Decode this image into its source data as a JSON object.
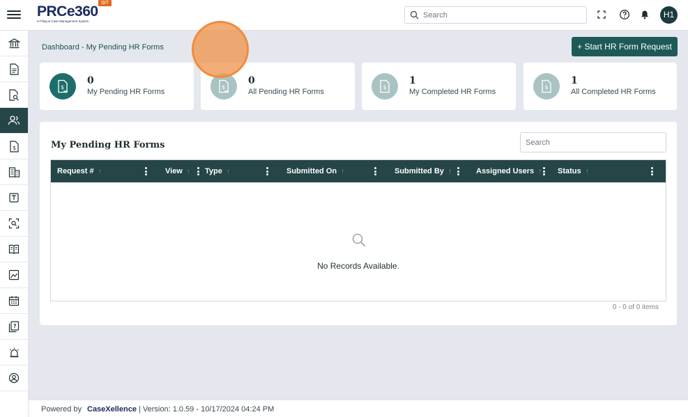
{
  "app": {
    "logo_text": "PRCe360",
    "logo_sub": "e-Filing & Case Management System",
    "env_badge": "SIT"
  },
  "topbar": {
    "search_placeholder": "Search",
    "icons": [
      "fullscreen-icon",
      "help-icon",
      "bell-icon"
    ],
    "avatar_initials": "H1"
  },
  "sidebar": {
    "items": [
      {
        "name": "institution-icon"
      },
      {
        "name": "document-icon"
      },
      {
        "name": "document-search-icon"
      },
      {
        "name": "users-icon",
        "active": true
      },
      {
        "name": "dollar-document-icon"
      },
      {
        "name": "building-icon"
      },
      {
        "name": "template-icon"
      },
      {
        "name": "scan-icon"
      },
      {
        "name": "book-icon"
      },
      {
        "name": "chart-icon"
      },
      {
        "name": "calendar-icon"
      },
      {
        "name": "question-document-icon"
      },
      {
        "name": "alarm-icon"
      },
      {
        "name": "user-circle-icon"
      }
    ]
  },
  "breadcrumb": "Dashboard - My Pending HR Forms",
  "start_button": "+ Start HR Form Request",
  "cards": [
    {
      "value": "0",
      "label": "My Pending HR Forms",
      "color": "#1d6e6b"
    },
    {
      "value": "0",
      "label": "All Pending HR Forms",
      "color": "#a9c3c3"
    },
    {
      "value": "1",
      "label": "My Completed HR Forms",
      "color": "#a9c3c3"
    },
    {
      "value": "1",
      "label": "All Completed HR Forms",
      "color": "#a9c3c3"
    }
  ],
  "panel": {
    "title": "My Pending HR Forms",
    "search_placeholder": "Search",
    "columns": [
      {
        "label": "Request #",
        "sortable": true
      },
      {
        "label": "View",
        "sortable": true
      },
      {
        "label": "Type",
        "sortable": true
      },
      {
        "label": "Submitted On",
        "sortable": true
      },
      {
        "label": "Submitted By",
        "sortable": true
      },
      {
        "label": "Assigned Users",
        "sortable": true
      },
      {
        "label": "Status",
        "sortable": true
      }
    ],
    "empty_text": "No Records Available.",
    "pager_text": "0 - 0 of 0 items"
  },
  "footer": {
    "powered_by": "Powered by",
    "brand": "CaseXellence",
    "version": "|   Version: 1.0.59 - 10/17/2024 04:24 PM"
  },
  "colors": {
    "accent": "#254546",
    "button": "#1d5a57",
    "touch_indicator": "#f08c3c"
  }
}
